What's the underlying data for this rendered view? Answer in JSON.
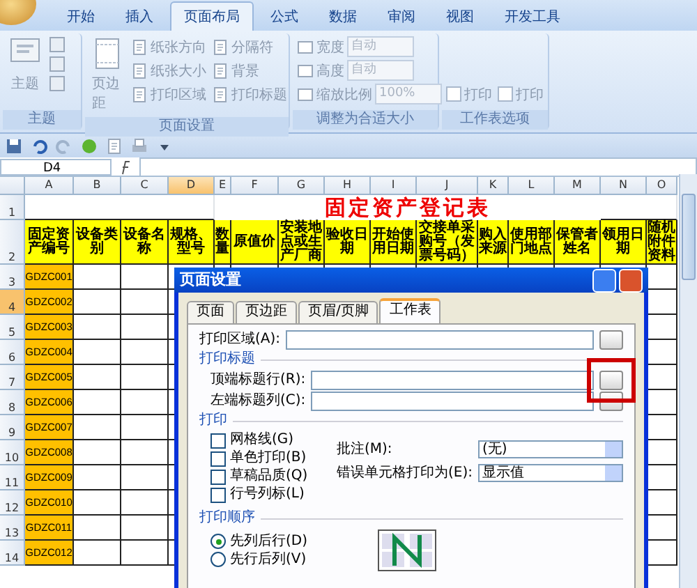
{
  "ribbon": {
    "tabs": [
      {
        "label": "开始",
        "selected": false
      },
      {
        "label": "插入",
        "selected": false
      },
      {
        "label": "页面布局",
        "selected": true
      },
      {
        "label": "公式",
        "selected": false
      },
      {
        "label": "数据",
        "selected": false
      },
      {
        "label": "审阅",
        "selected": false
      },
      {
        "label": "视图",
        "selected": false
      },
      {
        "label": "开发工具",
        "selected": false
      }
    ],
    "theme_group": {
      "button": "主题",
      "label": "主题"
    },
    "page_setup_group": {
      "button": "页边距",
      "items": [
        "纸张方向",
        "纸张大小",
        "打印区域"
      ],
      "items_2": [
        "分隔符",
        "背景",
        "打印标题"
      ],
      "label": "页面设置"
    },
    "scale_group": {
      "rows": [
        {
          "label": "宽度",
          "value": "自动"
        },
        {
          "label": "高度",
          "value": "自动"
        },
        {
          "label": "缩放比例",
          "value": "100%"
        }
      ],
      "label": "调整为合适大小"
    },
    "sheet_options_group": {
      "checkboxes": [
        {
          "label": "打印",
          "checked": false
        },
        {
          "label": "打印",
          "checked": false
        }
      ],
      "label": "工作表选项"
    }
  },
  "formula_bar": {
    "name_box": "D4"
  },
  "sheet": {
    "columns": [
      {
        "label": "A",
        "selected": false
      },
      {
        "label": "B",
        "selected": false
      },
      {
        "label": "C",
        "selected": false
      },
      {
        "label": "D",
        "selected": true
      },
      {
        "label": "E",
        "selected": false
      },
      {
        "label": "F",
        "selected": false
      },
      {
        "label": "G",
        "selected": false
      },
      {
        "label": "H",
        "selected": false
      },
      {
        "label": "I",
        "selected": false
      },
      {
        "label": "J",
        "selected": false
      },
      {
        "label": "K",
        "selected": false
      },
      {
        "label": "L",
        "selected": false
      },
      {
        "label": "M",
        "selected": false
      },
      {
        "label": "N",
        "selected": false
      },
      {
        "label": "O",
        "selected": false
      }
    ],
    "title_row_number": "1",
    "header_row_number": "2",
    "title": "固定资产登记表",
    "headers": [
      "固定资产编号",
      "设备类别",
      "设备名称",
      "规格、型号",
      "数量",
      "原值价",
      "安装地点或生产厂商",
      "验收日期",
      "开始使用日期",
      "交接单采购号（发票号码）",
      "购入来源",
      "使用部门地点",
      "保管者姓名",
      "领用日期",
      "随机附件资料"
    ],
    "rows": [
      {
        "number": "3",
        "id": "GDZC001",
        "selected": false
      },
      {
        "number": "4",
        "id": "GDZC002",
        "selected": true
      },
      {
        "number": "5",
        "id": "GDZC003",
        "selected": false
      },
      {
        "number": "6",
        "id": "GDZC004",
        "selected": false
      },
      {
        "number": "7",
        "id": "GDZC005",
        "selected": false
      },
      {
        "number": "8",
        "id": "GDZC006",
        "selected": false
      },
      {
        "number": "9",
        "id": "GDZC007",
        "selected": false
      },
      {
        "number": "10",
        "id": "GDZC008",
        "selected": false
      },
      {
        "number": "11",
        "id": "GDZC009",
        "selected": false
      },
      {
        "number": "12",
        "id": "GDZC010",
        "selected": false
      },
      {
        "number": "13",
        "id": "GDZC011",
        "selected": false
      },
      {
        "number": "14",
        "id": "GDZC012",
        "selected": false
      }
    ]
  },
  "dialog": {
    "title": "页面设置",
    "tabs": [
      {
        "label": "页面",
        "selected": false
      },
      {
        "label": "页边距",
        "selected": false
      },
      {
        "label": "页眉/页脚",
        "selected": false
      },
      {
        "label": "工作表",
        "selected": true
      }
    ],
    "print_area_label": "打印区域(A):",
    "print_titles_heading": "打印标题",
    "title_rows_label": "顶端标题行(R):",
    "title_columns_label": "左端标题列(C):",
    "print_heading": "打印",
    "print_options": [
      {
        "label": "网格线(G)",
        "checked": false
      },
      {
        "label": "单色打印(B)",
        "checked": false
      },
      {
        "label": "草稿品质(Q)",
        "checked": false
      },
      {
        "label": "行号列标(L)",
        "checked": false
      }
    ],
    "comments_label": "批注(M):",
    "comments_value": "(无)",
    "errors_label": "错误单元格打印为(E):",
    "errors_value": "显示值",
    "order_heading": "打印顺序",
    "print_order": [
      {
        "label": "先列后行(D)",
        "selected": true
      },
      {
        "label": "先行后列(V)",
        "selected": false
      }
    ]
  }
}
